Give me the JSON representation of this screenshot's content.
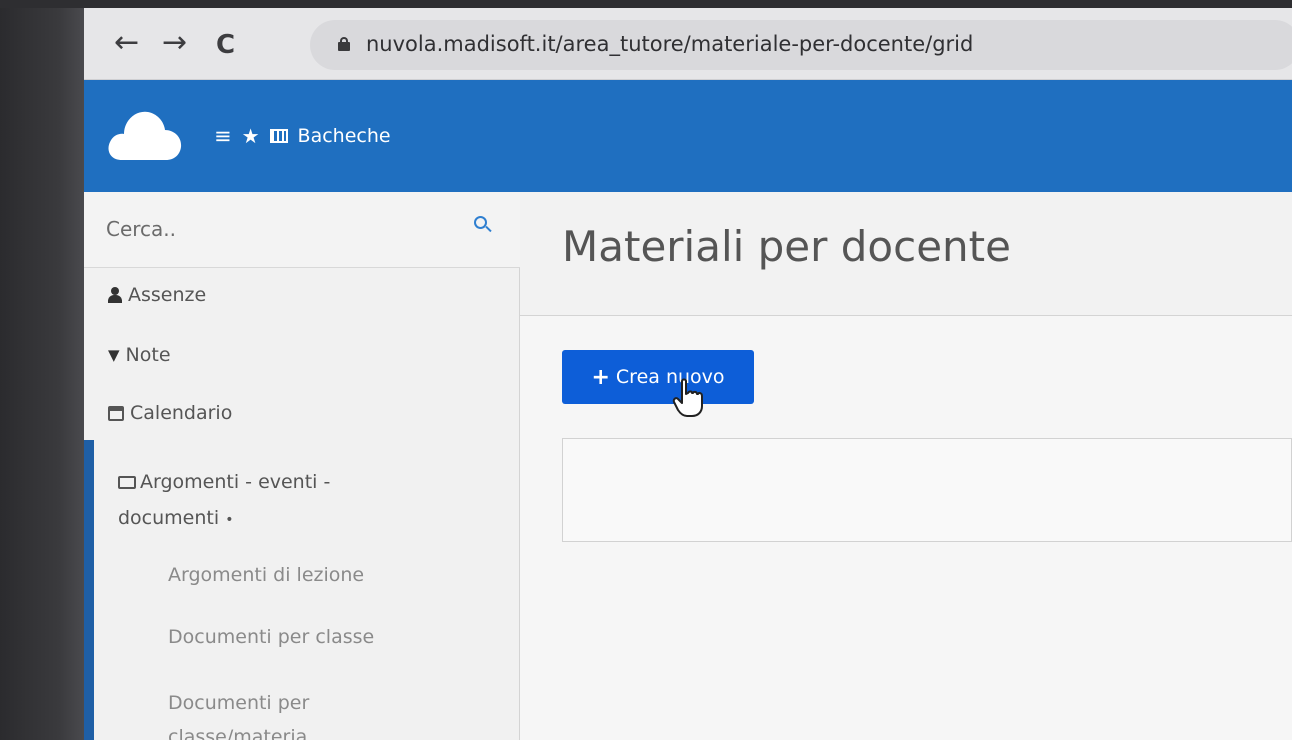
{
  "browser": {
    "back_icon": "←",
    "forward_icon": "→",
    "reload_icon": "C",
    "url": "nuvola.madisoft.it/area_tutore/materiale-per-docente/grid"
  },
  "header": {
    "menu_icon": "≡",
    "star_icon": "★",
    "boards_label": "Bacheche",
    "brand_color": "#1f6fc0"
  },
  "sidebar": {
    "search_placeholder": "Cerca..",
    "items": [
      {
        "label": "Assenze",
        "icon": "user-icon"
      },
      {
        "label": "Note",
        "icon": "pin-icon"
      },
      {
        "label": "Calendario",
        "icon": "calendar-icon"
      },
      {
        "label": "Argomenti - eventi - documenti",
        "icon": "folder-open-icon",
        "caret": "•"
      }
    ],
    "sub_items": [
      {
        "label": "Argomenti di lezione"
      },
      {
        "label": "Documenti per classe"
      },
      {
        "label": "Documenti per classe/materia"
      }
    ]
  },
  "main": {
    "title": "Materiali per docente",
    "create_button_label": "Crea nuovo",
    "create_button_color": "#0d5ed8"
  }
}
